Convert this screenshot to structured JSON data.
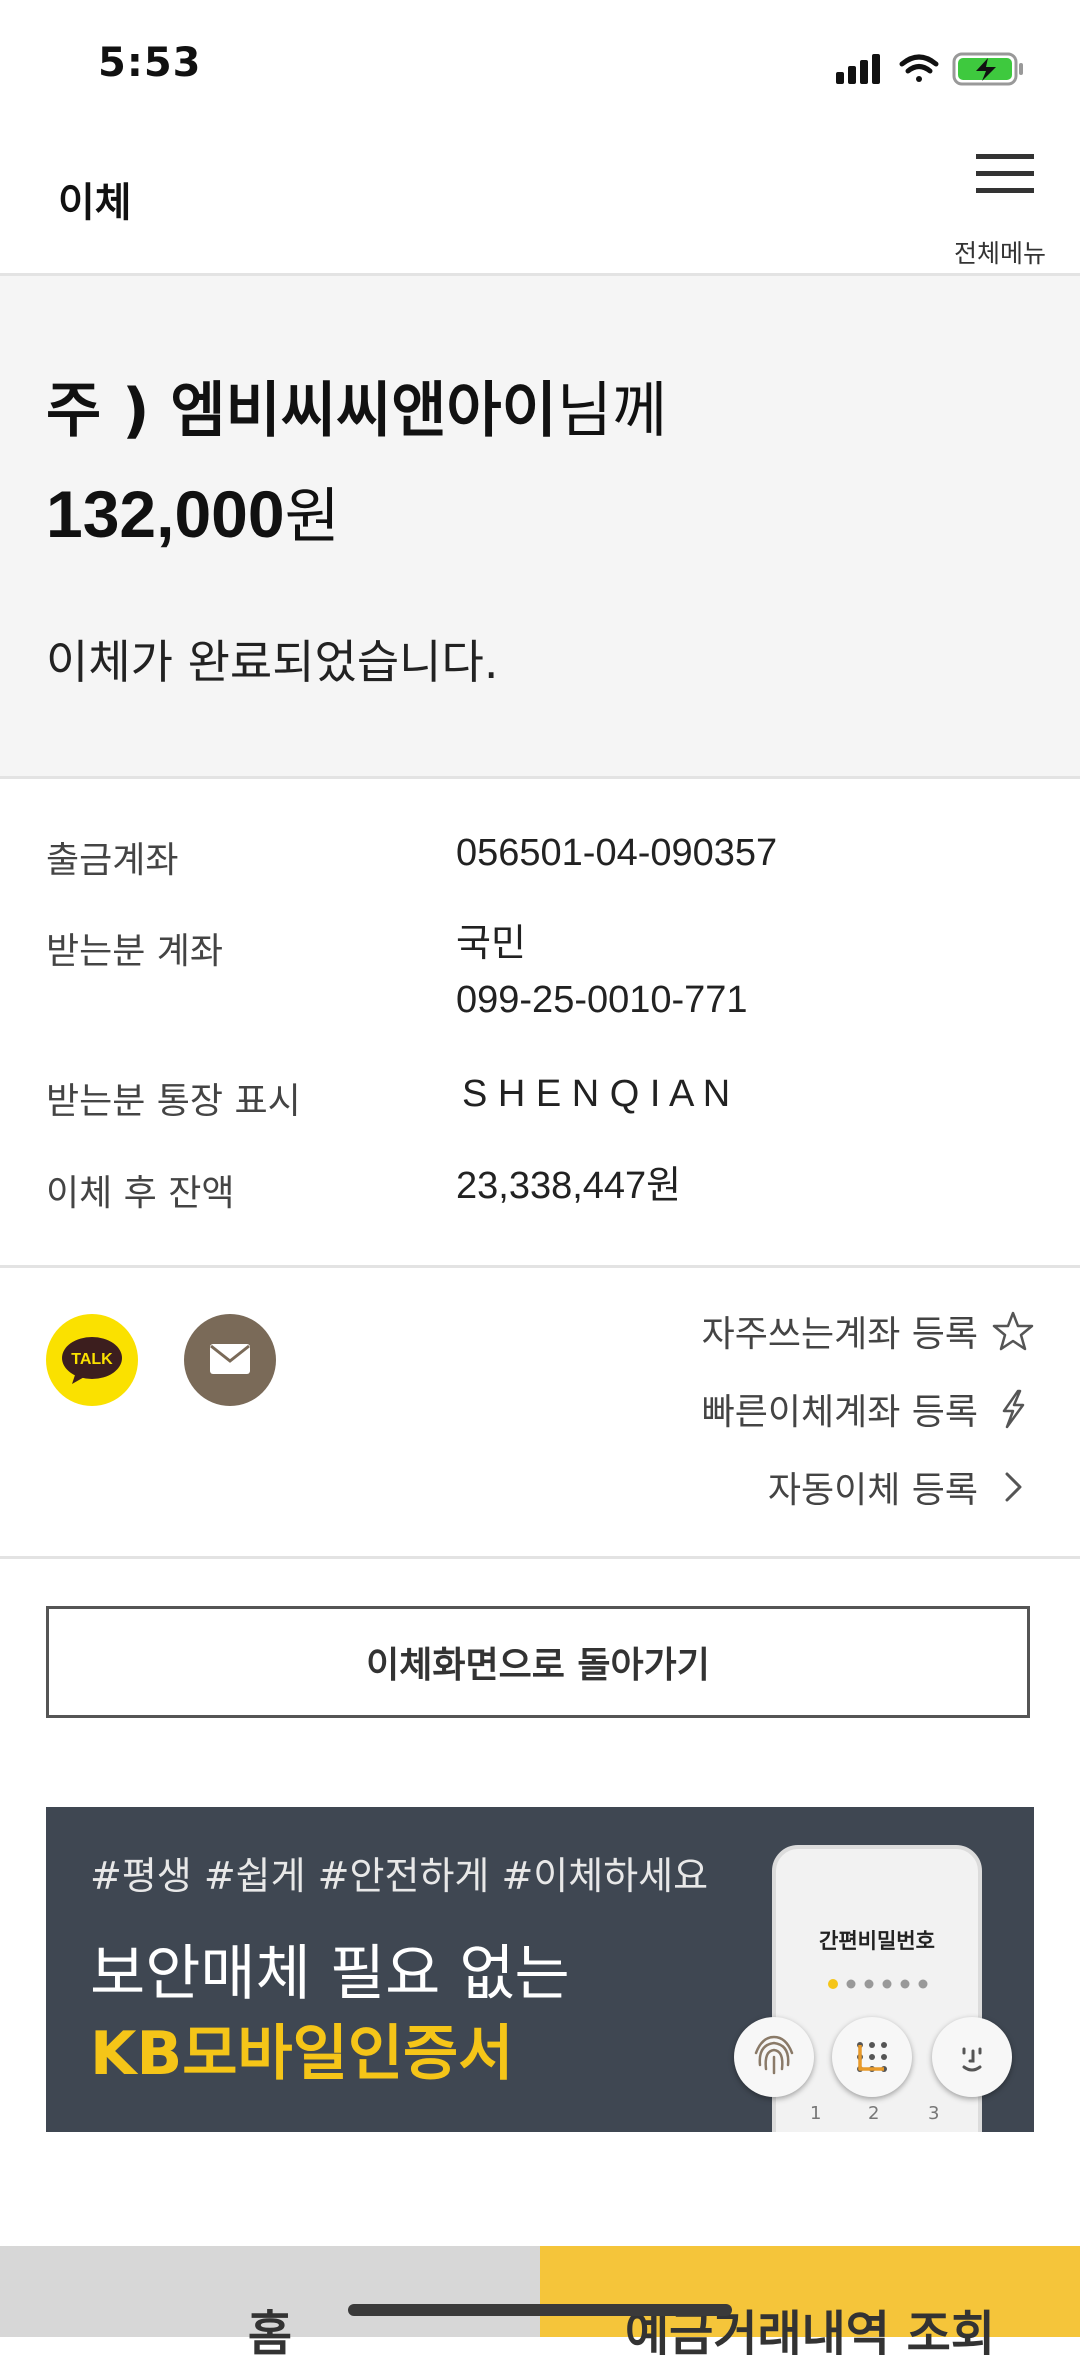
{
  "status_bar": {
    "time": "5:53",
    "icons": [
      "signal-icon",
      "wifi-icon",
      "battery-charging-icon"
    ]
  },
  "header": {
    "title": "이체",
    "menu_label": "전체메뉴"
  },
  "summary": {
    "recipient_name": "주 ) 엠비씨씨앤아이",
    "recipient_suffix": "님께",
    "amount": "132,000",
    "currency_unit": "원",
    "message": "이체가 완료되었습니다."
  },
  "details": [
    {
      "label": "출금계좌",
      "value": "056501-04-090357"
    },
    {
      "label": "받는분 계좌",
      "value": "국민",
      "value2": "099-25-0010-771"
    },
    {
      "label": "받는분 통장 표시",
      "value": "S H E N Q I A N"
    },
    {
      "label": "이체 후 잔액",
      "value": "23,338,447원"
    }
  ],
  "share": {
    "talk_icon_text": "TALK"
  },
  "links": [
    {
      "label": "자주쓰는계좌 등록",
      "icon": "star-icon"
    },
    {
      "label": "빠른이체계좌 등록",
      "icon": "lightning-icon"
    },
    {
      "label": "자동이체 등록",
      "icon": "chevron-right-icon"
    }
  ],
  "back_button": "이체화면으로 돌아가기",
  "banner": {
    "tags": "#평생 #쉽게 #안전하게 #이체하세요",
    "line1": "보안매체 필요 없는",
    "line2": "KB모바일인증서",
    "phone_title": "간편비밀번호",
    "keypad": [
      "1",
      "2",
      "3"
    ],
    "colors": {
      "background": "#3f4752",
      "accent": "#f5c518"
    }
  },
  "tabbar": {
    "home": "홈",
    "history": "예금거래내역 조회"
  },
  "colors": {
    "kakao_yellow": "#fae100",
    "mail_brown": "#7a6a58",
    "kb_yellow": "#f5c53a"
  }
}
